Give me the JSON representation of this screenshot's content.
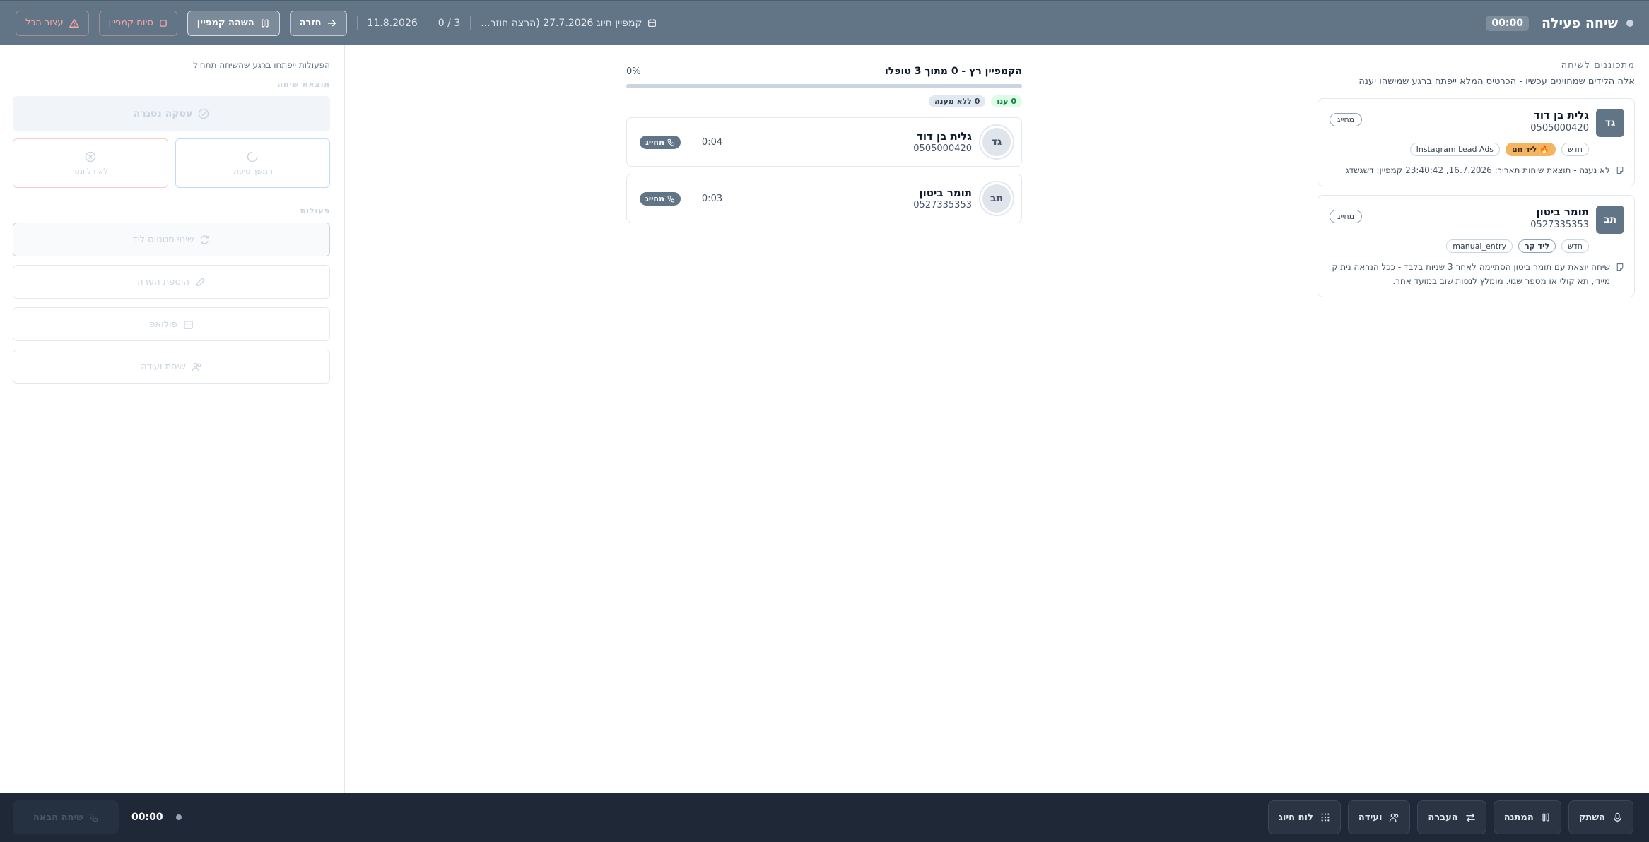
{
  "topbar": {
    "title": "שיחה פעילה",
    "timer": "00:00",
    "campaign_label": "קמפיין חיוג 27.7.2026 (הרצה חוזר...",
    "progress_count": "0 / 3",
    "date": "11.8.2026",
    "back_label": "חזרה",
    "pause_label": "השהה קמפיין",
    "end_campaign_label": "סיום קמפיין",
    "stop_all_label": "עצור הכל"
  },
  "queue": {
    "title": "מתכוננים לשיחה",
    "subtitle": "אלה הלידים שמחויגים עכשיו - הכרטיס המלא ייפתח ברגע שמישהו יענה",
    "leads": [
      {
        "initials": "גד",
        "name": "גלית בן דוד",
        "phone": "0505000420",
        "status_pill": "מחייג",
        "tags": [
          "חדש",
          "ליד חם",
          "Instagram Lead Ads"
        ],
        "note": "לא נענה - תוצאת שיחות תאריך: 16.7.2026, 23:40:42 קמפיין: דשגשדג"
      },
      {
        "initials": "תב",
        "name": "תומר ביטון",
        "phone": "0527335353",
        "status_pill": "מחייג",
        "tags": [
          "חדש",
          "ליד קר",
          "manual_entry"
        ],
        "note": "שיחה יוצאת עם תומר ביטון הסתיימה לאחר 3 שניות בלבד - ככל הנראה ניתוק מיידי, תא קולי או מספר שגוי. מומלץ לנסות שוב במועד אחר."
      }
    ]
  },
  "campaign": {
    "title": "הקמפיין רץ - 0 מתוך 3 טופלו",
    "percent_label": "0%",
    "progress": 0,
    "answered_label": "0 ענו",
    "no_answer_label": "0 ללא מענה",
    "calls": [
      {
        "initials": "גד",
        "name": "גלית בן דוד",
        "phone": "0505000420",
        "duration": "0:04",
        "badge": "מחייג"
      },
      {
        "initials": "תב",
        "name": "תומר ביטון",
        "phone": "0527335353",
        "duration": "0:03",
        "badge": "מחייג"
      }
    ]
  },
  "actions_panel": {
    "hint": "הפעולות ייפתחו ברגע שהשיחה תתחיל",
    "outcome_title": "תוצאת שיחה",
    "deal_closed_label": "עסקה נסגרה",
    "in_progress_label": "המשך טיפול",
    "not_relevant_label": "לא רלוונטי",
    "actions_title": "פעולות",
    "change_status_label": "שינוי סטטוס ליד",
    "add_note_label": "הוספת הערה",
    "followup_label": "פולואפ",
    "meeting_label": "שיחת ועידה"
  },
  "bottombar": {
    "mute_label": "השתק",
    "hold_label": "המתנה",
    "transfer_label": "העברה",
    "conference_label": "ועידה",
    "dialpad_label": "לוח חיוג",
    "timer": "00:00",
    "end_call_label": "שיחה הבאה"
  },
  "colors": {
    "topbar_bg": "#627587",
    "bottombar_bg": "#1e2837",
    "hot_tag": "#f5b45f",
    "answered_green": "#15803d"
  }
}
